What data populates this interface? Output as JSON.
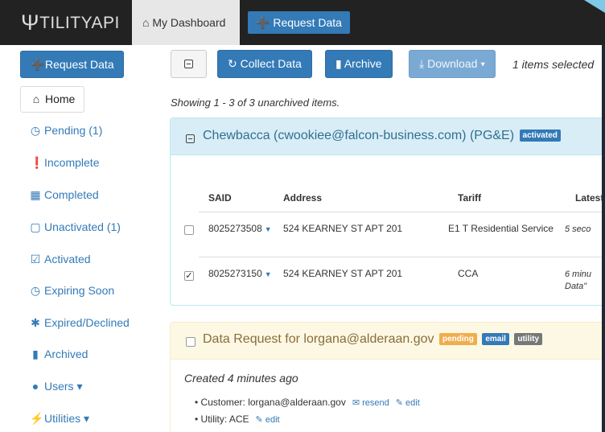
{
  "navbar": {
    "brand_glyph": "Ψ",
    "brand_rest": "TILITYAPI",
    "home_label": "My Dashboard",
    "request_label": "Request Data"
  },
  "sidebar": {
    "request_label": "Request Data",
    "home_label": "Home",
    "items": [
      {
        "label": "Pending (1)",
        "icon": "clock-icon"
      },
      {
        "label": "Incomplete",
        "icon": "info-icon"
      },
      {
        "label": "Completed",
        "icon": "grid-icon"
      },
      {
        "label": "Unactivated (1)",
        "icon": "empty-square-icon"
      },
      {
        "label": "Activated",
        "icon": "check-square-icon"
      },
      {
        "label": "Expiring Soon",
        "icon": "clock-icon"
      },
      {
        "label": "Expired/Declined",
        "icon": "asterisk-icon"
      },
      {
        "label": "Archived",
        "icon": "folder-icon"
      },
      {
        "label": "Users ▾",
        "icon": "user-icon"
      },
      {
        "label": "Utilities ▾",
        "icon": "bolt-icon"
      }
    ]
  },
  "toolbar": {
    "collect_label": "Collect Data",
    "archive_label": "Archive",
    "download_label": "Download ▾",
    "selected_text": "1 items selected",
    "showing_text": "Showing 1 - 3 of 3 unarchived items."
  },
  "panel1": {
    "title": "Chewbacca (cwookiee@falcon-business.com) (PG&E)",
    "badge": "activated",
    "columns": [
      "SAID",
      "Address",
      "Tariff",
      "Latest"
    ],
    "rows": [
      {
        "said": "8025273508",
        "address": "524 KEARNEY ST APT 201",
        "tariff": "E1 T Residential Service",
        "latest_1": "5 seco",
        "latest_2": "",
        "checked": false
      },
      {
        "said": "8025273150",
        "address": "524 KEARNEY ST APT 201",
        "tariff": "CCA",
        "latest_1": "6 minu",
        "latest_2": "Data\" ",
        "checked": true
      }
    ]
  },
  "panel2": {
    "title": "Data Request for lorgana@alderaan.gov",
    "badges": [
      "pending",
      "email",
      "utility"
    ],
    "created": "Created 4 minutes ago",
    "customer_text": "• Customer: lorgana@alderaan.gov",
    "resend_label": "resend",
    "edit_label": "edit",
    "utility_text": "• Utility: ACE"
  },
  "colors": {
    "navbar": "#222222",
    "primary": "#337ab7",
    "info_bg": "#d9edf7",
    "warning_bg": "#fcf8e3"
  }
}
